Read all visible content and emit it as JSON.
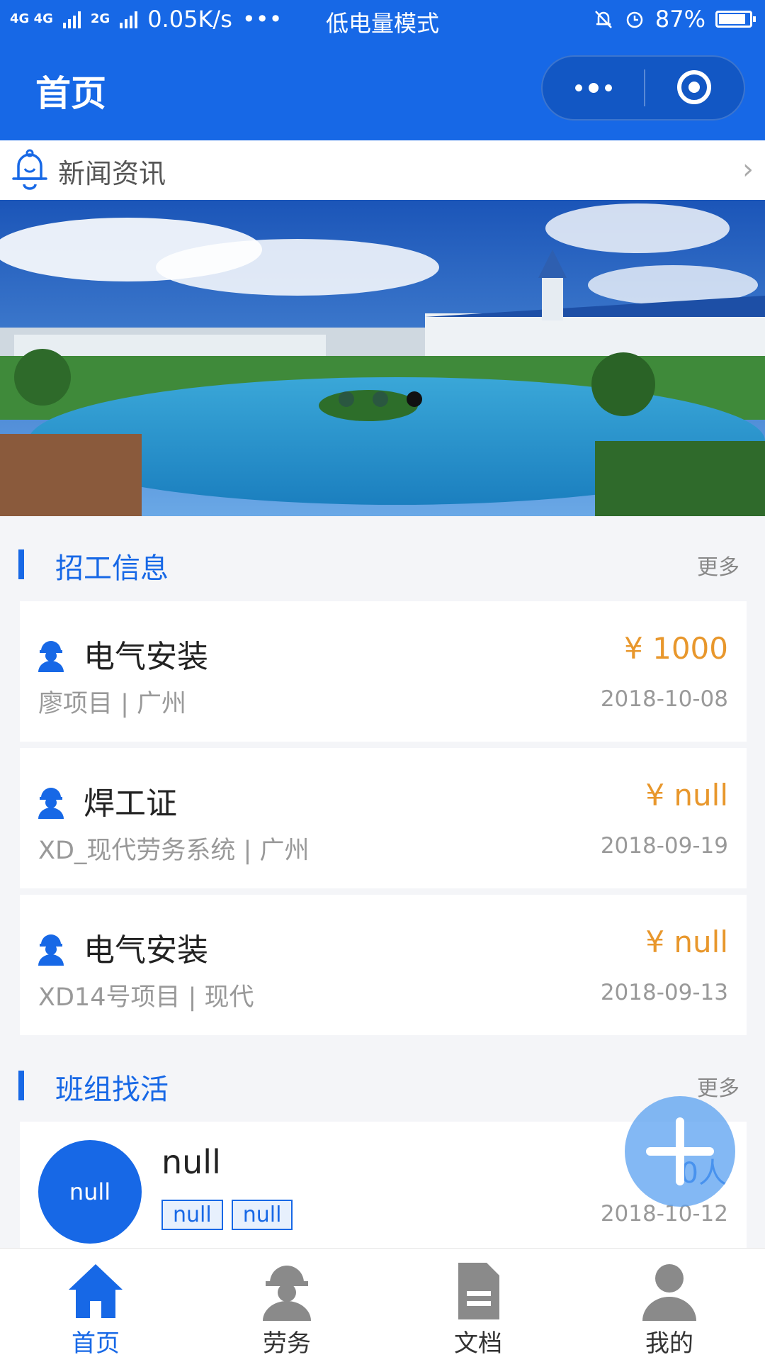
{
  "status_bar": {
    "network": "4G 4G",
    "network2": "2G",
    "speed": "0.05K/s",
    "more": "•••",
    "mode": "低电量模式",
    "battery": "87%",
    "battery_level": 0.87
  },
  "navbar": {
    "title": "首页"
  },
  "news": {
    "label": "新闻资讯",
    "chevron": "›"
  },
  "banner": {
    "slides": 3,
    "active_slide": 3
  },
  "recruit": {
    "title": "招工信息",
    "more": "更多",
    "items": [
      {
        "title": "电气安装",
        "price": "¥ 1000",
        "project": "廖项目 | 广州",
        "date": "2018-10-08"
      },
      {
        "title": "焊工证",
        "price": "¥ null",
        "project": "XD_现代劳务系统 | 广州",
        "date": "2018-09-19"
      },
      {
        "title": "电气安装",
        "price": "¥ null",
        "project": "XD14号项目 | 现代",
        "date": "2018-09-13"
      }
    ]
  },
  "team": {
    "title": "班组找活",
    "more": "更多",
    "item": {
      "avatar": "null",
      "name": "null",
      "tags": [
        "null",
        "null"
      ],
      "count": "0人",
      "date": "2018-10-12"
    }
  },
  "tabbar": {
    "tabs": [
      {
        "label": "首页",
        "icon": "home-icon",
        "active": true
      },
      {
        "label": "劳务",
        "icon": "worker-icon",
        "active": false
      },
      {
        "label": "文档",
        "icon": "document-icon",
        "active": false
      },
      {
        "label": "我的",
        "icon": "user-icon",
        "active": false
      }
    ]
  },
  "colors": {
    "primary": "#1768e6",
    "price": "#e8972c",
    "background": "#f4f5f8"
  }
}
